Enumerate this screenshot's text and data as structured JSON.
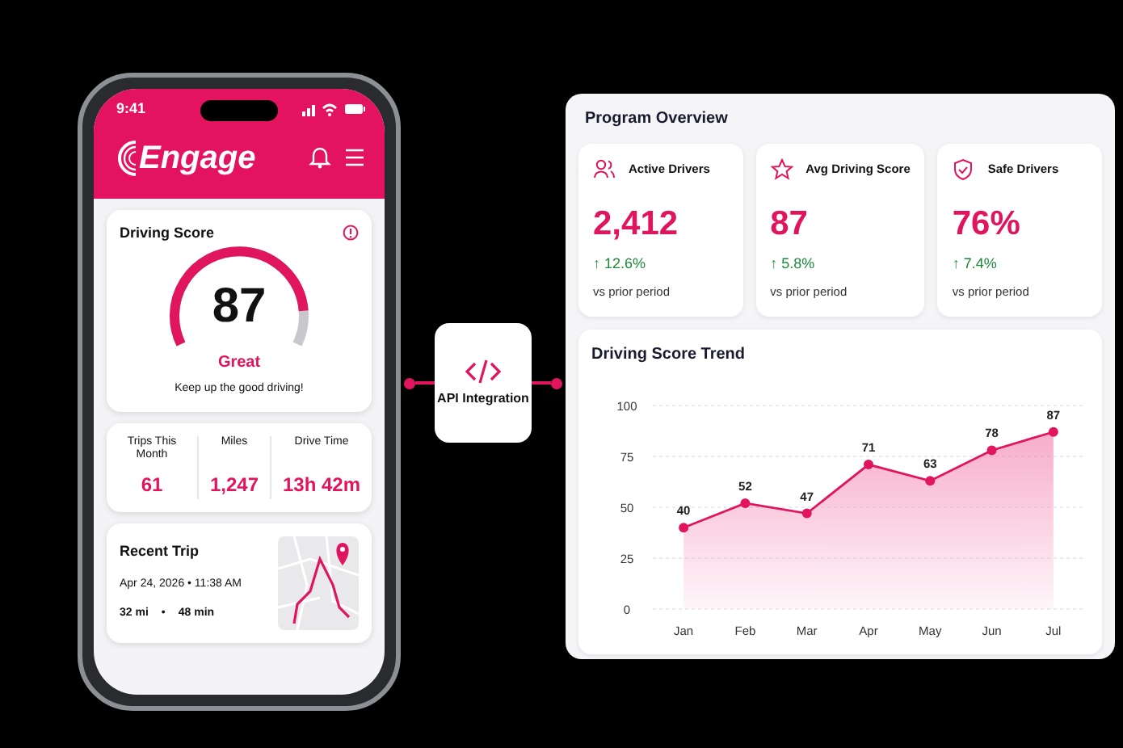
{
  "phone": {
    "status_bar": {
      "time": "9:41"
    },
    "app_name": "Engage",
    "driving_score": {
      "title": "Driving Score",
      "score": "87",
      "rating": "Great",
      "message": "Keep up the good driving!"
    },
    "stats": [
      {
        "label": "Trips This Month",
        "value": "61"
      },
      {
        "label": "Miles",
        "value": "1,247"
      },
      {
        "label": "Drive Time",
        "value": "13h 42m"
      }
    ],
    "recent_trip": {
      "title": "Recent Trip",
      "datetime": "Apr 24, 2026 • 11:38 AM",
      "distance": "32 mi",
      "separator": "•",
      "duration": "48 min"
    }
  },
  "integration": {
    "label": "API Integration"
  },
  "dashboard": {
    "overview": {
      "title": "Program Overview",
      "metrics": [
        {
          "kind": "people",
          "label": "Active Drivers",
          "value": "2,412",
          "change": "↑ 12.6%",
          "note": "vs prior period"
        },
        {
          "kind": "star",
          "label": "Avg Driving Score",
          "value": "87",
          "change": "↑ 5.8%",
          "note": "vs prior period"
        },
        {
          "kind": "shield",
          "label": "Safe Drivers",
          "value": "76%",
          "change": "↑ 7.4%",
          "note": "vs prior period"
        }
      ]
    },
    "trend": {
      "title": "Driving Score Trend",
      "chart_data": {
        "type": "area",
        "categories": [
          "Jan",
          "Feb",
          "Mar",
          "Apr",
          "May",
          "Jun",
          "Jul"
        ],
        "series": [
          {
            "color": "#e0155e",
            "values": [
              40,
              52,
              47,
              71,
              63,
              78,
              87
            ]
          }
        ],
        "ylim": [
          0,
          100
        ],
        "yticks": [
          0,
          25,
          50,
          75,
          100
        ],
        "data_labels": true,
        "grid": true
      }
    }
  }
}
